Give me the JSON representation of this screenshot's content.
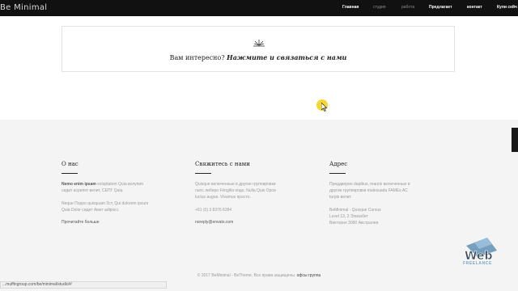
{
  "header": {
    "logo": "Be Minimal",
    "nav": [
      "Главная",
      "студия",
      "работа",
      "Предлагает",
      "контакт",
      "Купи сейч"
    ]
  },
  "banner": {
    "question": "Вам интересно?",
    "cta": "Нажмите и связаться с нами"
  },
  "footer": {
    "about": {
      "title": "О нас",
      "para1_bold": "Nemo enim ipsam",
      "para1_rest": " voluptatem Quia волупия",
      "para1_line2": "сидит асрепят велит, СЕПГ Quia.",
      "para2_line1": "Neque Порро quisquam Зст, Qui dolorem ipsum",
      "para2_line2": "Quia Dolor сидит Амет adipisci.",
      "link": "Прочитайте больше"
    },
    "contact": {
      "title": "Свяжитесь с нами",
      "line1": "Quisque включенные в другие группировки",
      "line2": "nunc либеро Fringilla подо. Nulla Quis Орси",
      "line3": "luctus augue. Vivamus просто.",
      "phone": "+61 (0) 3 8376 6284",
      "email": "noreply@envato.com"
    },
    "address": {
      "title": "Адрес",
      "line1": "Преддверие dapibus, mauris включенные в",
      "line2": "другие группировки malesuada FAMEs AC",
      "line3": "turpis велит.",
      "addr1": "BeMinimal - Quisque Cursus",
      "addr2": "Level 13, 2 Элизабет",
      "addr3": "Виктория 3000 Австралия"
    },
    "copyright_text": "© 2017 BeMinimal - BeTheme. Все права защищены.",
    "copyright_link": "офсы группа"
  },
  "status_url": "...muffingroup.com/be/minimal/studio/#",
  "watermark": {
    "brand": "Web",
    "sub": "FREELANCE"
  },
  "colors": {
    "topbar": "#111111",
    "footer_bg": "#f4f4f4",
    "cursor_highlight": "#f5d21a"
  }
}
